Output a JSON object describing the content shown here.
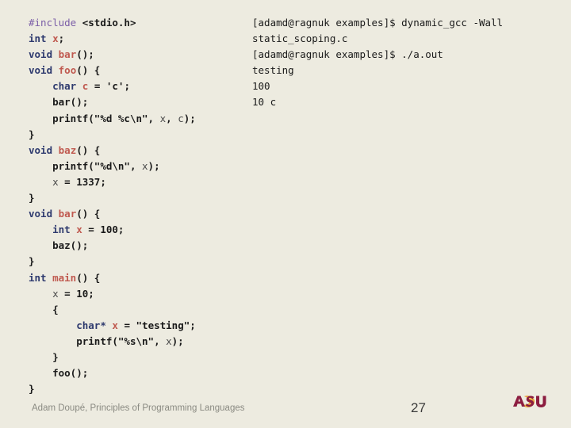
{
  "slide": {
    "background_color": "#EDEBE0",
    "page_number": "27",
    "footer_attribution": "Adam Doupé, Principles of Programming Languages"
  },
  "syntax_colors": {
    "preprocessor": "#7B5EA7",
    "keyword": "#2E3A6E",
    "function_name": "#C05A50",
    "string": "#1A1A1A",
    "number": "#1A1A1A",
    "identifier": "#4A4A4A",
    "punctuation": "#1A1A1A"
  },
  "code": {
    "language": "c",
    "filename": "static_scoping.c",
    "lines": [
      "#include <stdio.h>",
      "int x;",
      "void bar();",
      "void foo() {",
      "    char c = 'c';",
      "    bar();",
      "    printf(\"%d %c\\n\", x, c);",
      "}",
      "void baz() {",
      "    printf(\"%d\\n\", x);",
      "    x = 1337;",
      "}",
      "void bar() {",
      "    int x = 100;",
      "    baz();",
      "}",
      "int main() {",
      "    x = 10;",
      "    {",
      "        char* x = \"testing\";",
      "        printf(\"%s\\n\", x);",
      "    }",
      "    foo();",
      "}"
    ]
  },
  "terminal": {
    "prompt": "[adamd@ragnuk examples]$",
    "lines": [
      "[adamd@ragnuk examples]$ dynamic_gcc -Wall",
      "static_scoping.c",
      "[adamd@ragnuk examples]$ ./a.out",
      "testing",
      "100",
      "10 c"
    ]
  },
  "logo": {
    "name": "asu-logo",
    "text": "ASU",
    "maroon": "#8C1D40",
    "gold": "#E8A33D"
  }
}
